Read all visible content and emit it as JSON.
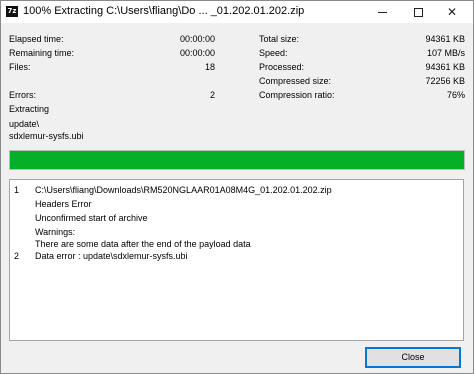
{
  "titlebar": {
    "icon_text": "7z",
    "title": "100% Extracting C:\\Users\\fliang\\Do ... _01.202.01.202.zip",
    "minimize_icon": "minimize-icon",
    "maximize_icon": "maximize-icon",
    "close_glyph": "✕"
  },
  "stats_left": [
    {
      "label": "Elapsed time:",
      "value": "00:00:00"
    },
    {
      "label": "Remaining time:",
      "value": "00:00:00"
    },
    {
      "label": "Files:",
      "value": "18"
    },
    {
      "label": "Errors:",
      "value": "2"
    }
  ],
  "stats_right": [
    {
      "label": "Total size:",
      "value": "94361 KB"
    },
    {
      "label": "Speed:",
      "value": "107 MB/s"
    },
    {
      "label": "Processed:",
      "value": "94361 KB"
    },
    {
      "label": "Compressed size:",
      "value": "72256 KB"
    },
    {
      "label": "Compression ratio:",
      "value": "76%"
    }
  ],
  "status": {
    "operation": "Extracting",
    "current_dir": "update\\",
    "current_file": "sdxlemur-sysfs.ubi"
  },
  "progress": {
    "fraction": 1.0,
    "color": "#06b025"
  },
  "log": [
    {
      "num": "1",
      "text": "C:\\Users\\fliang\\Downloads\\RM520NGLAAR01A08M4G_01.202.01.202.zip"
    },
    {
      "num": "",
      "text": "Headers Error"
    },
    {
      "num": "",
      "text": "Unconfirmed start of archive"
    },
    {
      "num": "",
      "text": "Warnings:"
    },
    {
      "num": "",
      "text": "There are some data after the end of the payload data"
    },
    {
      "num": "2",
      "text": "Data error : update\\sdxlemur-sysfs.ubi"
    }
  ],
  "buttons": {
    "close_label": "Close"
  }
}
